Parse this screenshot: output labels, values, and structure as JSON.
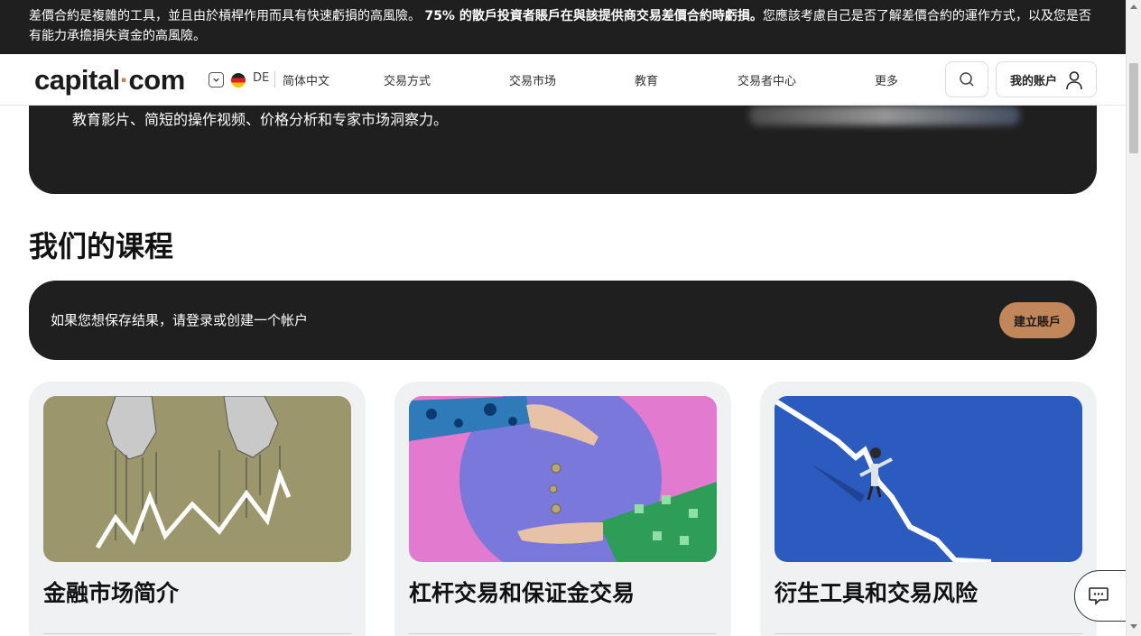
{
  "risk_banner": {
    "text_1": "差價合約是複雜的工具，並且由於槓桿作用而具有快速虧損的高風險。",
    "text_bold": "75% 的散戶投資者賬戶在與該提供商交易差價合約時虧損。",
    "text_2": "您應該考慮自己是否了解差價合約的運作方式，以及您是否有能力承擔損失資金的高風險。"
  },
  "header": {
    "logo_part1": "capital",
    "logo_dot": "·",
    "logo_part2": "com",
    "lang_code": "DE",
    "lang_name": "简体中文",
    "nav": [
      "交易方式",
      "交易市场",
      "教育",
      "交易者中心",
      "更多"
    ],
    "account_label": "我的账户"
  },
  "hero": {
    "text": "教育影片、简短的操作视频、价格分析和专家市场洞察力。"
  },
  "section": {
    "title": "我们的课程"
  },
  "save_bar": {
    "text": "如果您想保存结果，请登录或创建一个帐户",
    "button": "建立賬戶"
  },
  "courses": [
    {
      "title": "金融市场简介",
      "image": "puppet-hands-chart-image"
    },
    {
      "title": "杠杆交易和保证金交易",
      "image": "coins-hands-image"
    },
    {
      "title": "衍生工具和交易风险",
      "image": "man-on-falling-chart-image"
    }
  ],
  "colors": {
    "accent": "#c1875b",
    "dark": "#1f1f1f",
    "card_bg": "#f0f1f3"
  },
  "icons": {
    "search": "search-icon",
    "account": "user-icon",
    "chat": "chat-icon",
    "chevron": "chevron-down-icon",
    "flag": "germany-flag-icon"
  }
}
